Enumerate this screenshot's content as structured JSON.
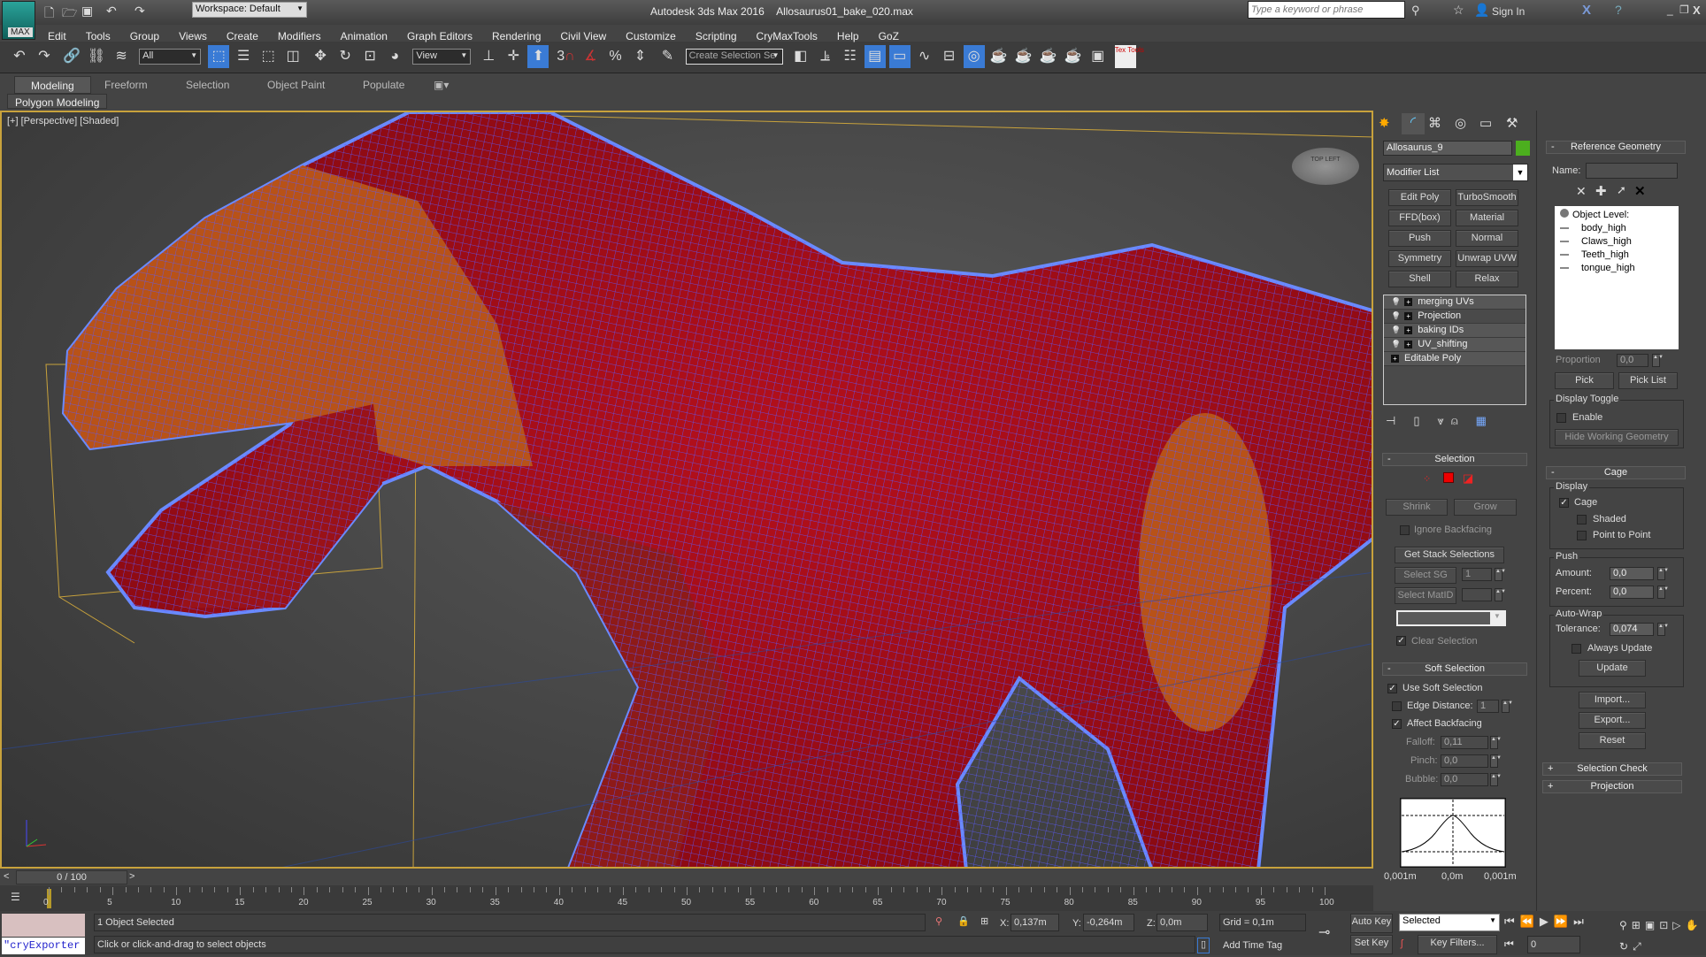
{
  "title_bar": {
    "app_title": "Autodesk 3ds Max 2016",
    "file_name": "Allosaurus01_bake_020.max",
    "workspace": "Workspace: Default",
    "search_placeholder": "Type a keyword or phrase",
    "sign_in": "Sign In",
    "logo_text": "MAX"
  },
  "menu": [
    "Edit",
    "Tools",
    "Group",
    "Views",
    "Create",
    "Modifiers",
    "Animation",
    "Graph Editors",
    "Rendering",
    "Civil View",
    "Customize",
    "Scripting",
    "CryMaxTools",
    "Help",
    "GoZ"
  ],
  "toolbar": {
    "filter_value": "All",
    "ref_coord_value": "View",
    "selection_set_placeholder": "Create Selection Se",
    "icons_left": [
      "undo-icon",
      "redo-icon",
      "link-icon",
      "unlink-icon",
      "bind-space-warp-icon"
    ],
    "icons_mid": [
      "select-object-icon",
      "select-by-name-icon",
      "rect-selection-icon",
      "window-crossing-icon",
      "move-icon",
      "rotate-icon",
      "scale-icon",
      "placement-icon"
    ],
    "snap_label": "3",
    "percent_label": "%",
    "texttools_label": "Tex Tools"
  },
  "ribbon": {
    "tabs": [
      "Modeling",
      "Freeform",
      "Selection",
      "Object Paint",
      "Populate"
    ],
    "active_tab": "Modeling",
    "sub_panel": "Polygon Modeling"
  },
  "viewport": {
    "label": "[+] [Perspective] [Shaded]",
    "viewcube_label": "TOP LEFT",
    "wire_color": "#5a5aff",
    "mesh_red": "#a3101c",
    "mesh_orange": "#c2561a"
  },
  "command_panel": {
    "object_name": "Allosaurus_9",
    "object_color": "#4caf1e",
    "modifier_list": "Modifier List",
    "modifier_buttons": [
      "Edit Poly",
      "TurboSmooth",
      "FFD(box)",
      "Material",
      "Push",
      "Normal",
      "Symmetry",
      "Unwrap UVW",
      "Shell",
      "Relax"
    ],
    "stack": [
      {
        "label": "merging UVs"
      },
      {
        "label": "Projection"
      },
      {
        "label": "baking IDs"
      },
      {
        "label": "UV_shifting"
      },
      {
        "label": "Editable Poly"
      }
    ],
    "selection": {
      "title": "Selection",
      "shrink": "Shrink",
      "grow": "Grow",
      "ignore_backfacing": "Ignore Backfacing",
      "ignore_backfacing_checked": false,
      "get_stack": "Get Stack Selections",
      "select_sg": "Select SG",
      "select_sg_value": "1",
      "select_matid": "Select MatID",
      "clear_selection": "Clear Selection",
      "clear_selection_checked": true
    },
    "soft_selection": {
      "title": "Soft Selection",
      "use_soft": "Use Soft Selection",
      "use_soft_checked": true,
      "edge_distance": "Edge Distance:",
      "edge_distance_value": "1",
      "edge_distance_checked": false,
      "affect_backfacing": "Affect Backfacing",
      "affect_backfacing_checked": true,
      "falloff_label": "Falloff:",
      "falloff": "0,11",
      "pinch_label": "Pinch:",
      "pinch": "0,0",
      "bubble_label": "Bubble:",
      "bubble": "0,0",
      "curve_labels": [
        "0,001m",
        "0,0m",
        "0,001m"
      ]
    }
  },
  "projection_panel": {
    "ref_geometry": {
      "title": "Reference Geometry",
      "name_label": "Name:",
      "list_header": "Object Level:",
      "objects": [
        "body_high",
        "Claws_high",
        "Teeth_high",
        "tongue_high"
      ],
      "proportion_label": "Proportion",
      "proportion": "0,0",
      "pick": "Pick",
      "pick_list": "Pick List",
      "display_toggle": "Display Toggle",
      "enable": "Enable",
      "hide_working": "Hide Working Geometry"
    },
    "cage": {
      "title": "Cage",
      "display": "Display",
      "cage": "Cage",
      "cage_checked": true,
      "shaded": "Shaded",
      "point_to_point": "Point to Point",
      "push": "Push",
      "amount_label": "Amount:",
      "amount": "0,0",
      "percent_label": "Percent:",
      "percent": "0,0",
      "auto_wrap": "Auto-Wrap",
      "tolerance_label": "Tolerance:",
      "tolerance": "0,074",
      "always_update": "Always Update",
      "update": "Update",
      "import": "Import...",
      "export": "Export...",
      "reset": "Reset"
    },
    "selection_check": "Selection Check",
    "projection": "Projection"
  },
  "timeline": {
    "frame_display": "0 / 100",
    "current_frame": 0,
    "ticks": [
      "0",
      "5",
      "10",
      "15",
      "20",
      "25",
      "30",
      "35",
      "40",
      "45",
      "50",
      "55",
      "60",
      "65",
      "70",
      "75",
      "80",
      "85",
      "90",
      "95",
      "100"
    ]
  },
  "status": {
    "selected": "1 Object Selected",
    "prompt": "Click or click-and-drag to select objects",
    "maxscript": "\"cryExporter",
    "x_label": "X:",
    "x": "0,137m",
    "y_label": "Y:",
    "y": "-0,264m",
    "z_label": "Z:",
    "z": "0,0m",
    "grid": "Grid = 0,1m",
    "add_time_tag": "Add Time Tag",
    "auto_key": "Auto Key",
    "set_key": "Set Key",
    "key_mode": "Selected",
    "key_filters": "Key Filters...",
    "frame": "0"
  }
}
